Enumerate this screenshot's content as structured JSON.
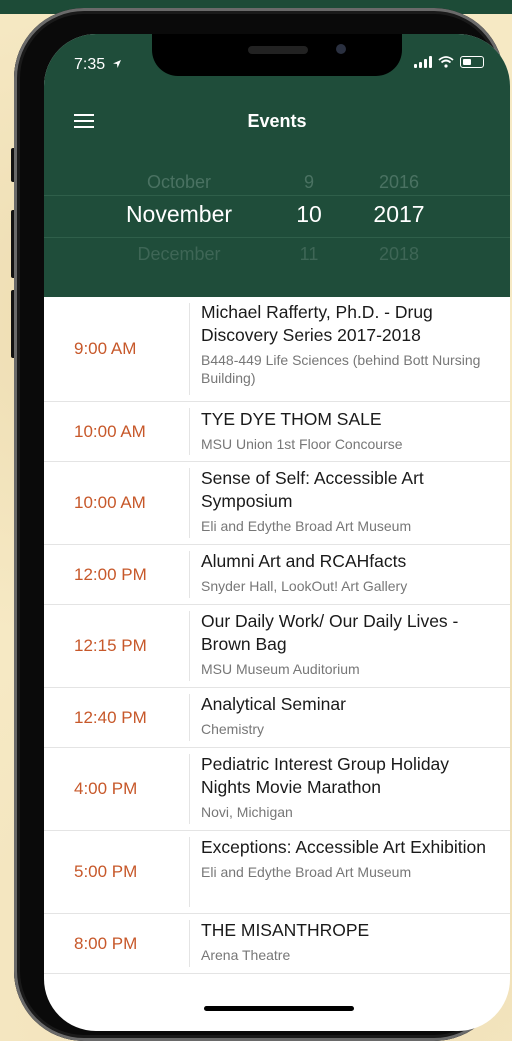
{
  "status": {
    "time": "7:35"
  },
  "header": {
    "title": "Events"
  },
  "picker": {
    "month": {
      "prev": "October",
      "current": "November",
      "next": "December"
    },
    "day": {
      "prev": "9",
      "current": "10",
      "next": "11"
    },
    "year": {
      "prev": "2016",
      "current": "2017",
      "next": "2018"
    }
  },
  "events": [
    {
      "time": "9:00 AM",
      "title": "Michael Rafferty, Ph.D. - Drug Discovery Series 2017-2018",
      "location": "B448-449 Life Sciences  (behind Bott Nursing Building)"
    },
    {
      "time": "10:00 AM",
      "title": "TYE DYE THOM SALE",
      "location": "MSU Union 1st Floor Concourse"
    },
    {
      "time": "10:00 AM",
      "title": "Sense of Self: Accessible Art Symposium",
      "location": "Eli and Edythe Broad Art Museum"
    },
    {
      "time": "12:00 PM",
      "title": "Alumni Art and RCAHfacts",
      "location": "Snyder Hall, LookOut! Art Gallery"
    },
    {
      "time": "12:15 PM",
      "title": "Our Daily Work/ Our Daily Lives - Brown Bag",
      "location": "MSU Museum Auditorium"
    },
    {
      "time": "12:40 PM",
      "title": "Analytical Seminar",
      "location": "Chemistry"
    },
    {
      "time": "4:00 PM",
      "title": "Pediatric Interest Group Holiday Nights Movie Marathon",
      "location": "Novi, Michigan"
    },
    {
      "time": "5:00 PM",
      "title": "Exceptions: Accessible Art Exhibition",
      "location": "Eli and Edythe Broad Art Museum"
    },
    {
      "time": "8:00 PM",
      "title": "THE MISANTHROPE",
      "location": "Arena Theatre"
    }
  ],
  "colors": {
    "header_bg": "#1f4d3a",
    "time_accent": "#c7582a",
    "background": "#f6e9c4"
  }
}
